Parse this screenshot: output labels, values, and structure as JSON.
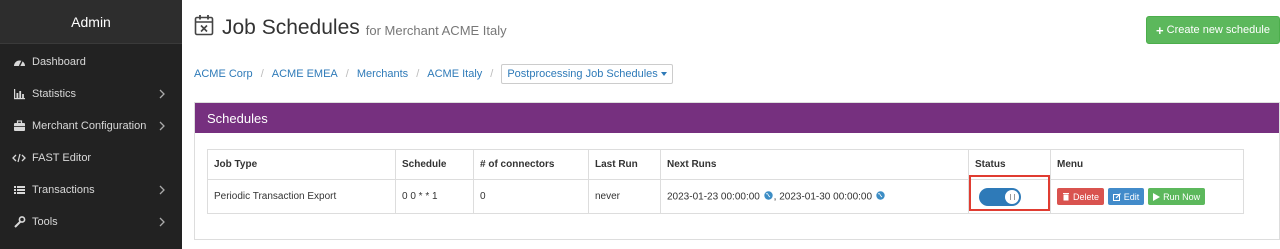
{
  "sidebar": {
    "header": "Admin",
    "items": [
      {
        "label": "Dashboard",
        "icon": "dashboard-icon",
        "has_submenu": false
      },
      {
        "label": "Statistics",
        "icon": "bar-chart-icon",
        "has_submenu": true
      },
      {
        "label": "Merchant Configuration",
        "icon": "briefcase-icon",
        "has_submenu": true
      },
      {
        "label": "FAST Editor",
        "icon": "code-icon",
        "has_submenu": false
      },
      {
        "label": "Transactions",
        "icon": "list-icon",
        "has_submenu": true
      },
      {
        "label": "Tools",
        "icon": "wrench-icon",
        "has_submenu": true
      }
    ]
  },
  "header": {
    "title": "Job Schedules",
    "subtitle": "for Merchant ACME Italy",
    "create_label": "Create new schedule"
  },
  "breadcrumb": {
    "items": [
      "ACME Corp",
      "ACME EMEA",
      "Merchants",
      "ACME Italy"
    ],
    "current": "Postprocessing Job Schedules"
  },
  "panel": {
    "title": "Schedules"
  },
  "table": {
    "headers": [
      "Job Type",
      "Schedule",
      "# of connectors",
      "Last Run",
      "Next Runs",
      "Status",
      "Menu"
    ],
    "rows": [
      {
        "job_type": "Periodic Transaction Export",
        "schedule": "0 0 * * 1",
        "connectors": "0",
        "last_run": "never",
        "next_run_1": "2023-01-23 00:00:00",
        "next_run_sep": ",",
        "next_run_2": "2023-01-30 00:00:00",
        "status_on": true,
        "delete_label": "Delete",
        "edit_label": "Edit",
        "run_label": "Run Now"
      }
    ]
  },
  "colors": {
    "sidebar_bg": "#222222",
    "panel_header": "#76307f",
    "primary": "#2e7ab8",
    "success": "#5cb85c",
    "danger": "#d9534f",
    "highlight": "#e03c31"
  }
}
